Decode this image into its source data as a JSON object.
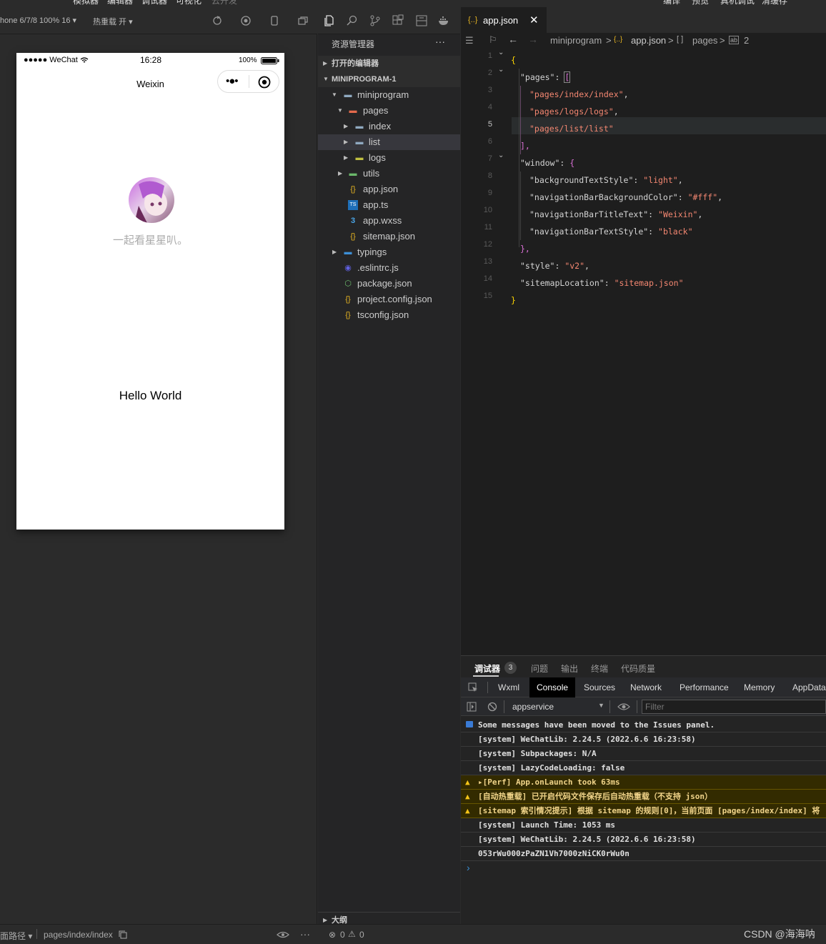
{
  "topbar": {
    "items": [
      "模拟器",
      "编辑器",
      "调试器",
      "可视化",
      "云开发",
      "编译",
      "预览",
      "真机调试",
      "清缓存"
    ]
  },
  "simulator": {
    "device": "hone 6/7/8 100% 16 ▾",
    "hotreload": "热重载 开 ▾",
    "status": {
      "carrier": "●●●●● WeChat",
      "time": "16:28",
      "battery": "100%"
    },
    "nav_title": "Weixin",
    "nickname": "一起看星星叭。",
    "hello": "Hello World"
  },
  "explorer": {
    "title": "资源管理器",
    "more": "···",
    "open_editors": "打开的编辑器",
    "project": "MINIPROGRAM-1",
    "tree": [
      {
        "label": "miniprogram",
        "icon": "folder-open-icon"
      },
      {
        "label": "pages",
        "icon": "folder-open-icon"
      },
      {
        "label": "index",
        "icon": "folder-icon"
      },
      {
        "label": "list",
        "icon": "folder-icon"
      },
      {
        "label": "logs",
        "icon": "folder-icon"
      },
      {
        "label": "utils",
        "icon": "folder-icon"
      },
      {
        "label": "app.json",
        "icon": "json-icon"
      },
      {
        "label": "app.ts",
        "icon": "ts-icon"
      },
      {
        "label": "app.wxss",
        "icon": "css-icon"
      },
      {
        "label": "sitemap.json",
        "icon": "json-icon"
      },
      {
        "label": "typings",
        "icon": "folder-icon"
      },
      {
        "label": ".eslintrc.js",
        "icon": "eslint-icon"
      },
      {
        "label": "package.json",
        "icon": "node-icon"
      },
      {
        "label": "project.config.json",
        "icon": "json-icon"
      },
      {
        "label": "tsconfig.json",
        "icon": "json-icon"
      }
    ],
    "outline": "大纲"
  },
  "editor": {
    "tab": "app.json",
    "crumbs": [
      "miniprogram",
      ">",
      "{..}",
      "app.json",
      ">",
      "[ ]",
      "pages",
      ">",
      "2"
    ],
    "lines": [
      "1",
      "2",
      "3",
      "4",
      "5",
      "6",
      "7",
      "8",
      "9",
      "10",
      "11",
      "12",
      "13",
      "14",
      "15"
    ],
    "code": {
      "l1": "{",
      "l2k": "\"pages\"",
      "l2p": ": ",
      "l2b": "[",
      "l3": "\"pages/index/index\"",
      "l3p": ",",
      "l4": "\"pages/logs/logs\"",
      "l4p": ",",
      "l5": "\"pages/list/list\"",
      "l6": "],",
      "l7k": "\"window\"",
      "l7p": ": ",
      "l7b": "{",
      "l8k": "\"backgroundTextStyle\"",
      "l8v": "\"light\"",
      "l9k": "\"navigationBarBackgroundColor\"",
      "l9v": "\"#fff\"",
      "l10k": "\"navigationBarTitleText\"",
      "l10v": "\"Weixin\"",
      "l11k": "\"navigationBarTextStyle\"",
      "l11v": "\"black\"",
      "l12": "},",
      "l13k": "\"style\"",
      "l13v": "\"v2\"",
      "l14k": "\"sitemapLocation\"",
      "l14v": "\"sitemap.json\"",
      "l15": "}",
      "colon": ": ",
      "comma": ","
    }
  },
  "console": {
    "tabs": [
      "调试器",
      "问题",
      "输出",
      "终端",
      "代码质量"
    ],
    "badge": "3",
    "devtabs": [
      "Wxml",
      "Console",
      "Sources",
      "Network",
      "Performance",
      "Memory",
      "AppData"
    ],
    "context": "appservice",
    "filter_placeholder": "Filter",
    "messages": [
      {
        "text": "Some messages have been moved to the Issues panel.",
        "type": "info"
      },
      {
        "text": "[system] WeChatLib: 2.24.5 (2022.6.6 16:23:58)",
        "type": "log"
      },
      {
        "text": "[system] Subpackages: N/A",
        "type": "log"
      },
      {
        "text": "[system] LazyCodeLoading: false",
        "type": "log"
      },
      {
        "text": "▸[Perf] App.onLaunch took 63ms",
        "type": "warn"
      },
      {
        "text": "[自动热重载] 已开启代码文件保存后自动热重载（不支持 json）",
        "type": "warn"
      },
      {
        "text": "[sitemap 索引情况提示] 根据 sitemap 的规则[0]，当前页面 [pages/index/index] 将",
        "type": "warn"
      },
      {
        "text": "[system] Launch Time: 1053 ms",
        "type": "log"
      },
      {
        "text": "[system] WeChatLib: 2.24.5 (2022.6.6 16:23:58)",
        "type": "log"
      },
      {
        "text": "053rWu000zPaZN1Vh7000zNiCK0rWu0n",
        "type": "log"
      }
    ],
    "prompt": "›"
  },
  "statusbar": {
    "path_label": "面路径 ▾",
    "path": "pages/index/index",
    "errors": "0",
    "warnings": "0",
    "watermark": "CSDN @海海呐"
  }
}
